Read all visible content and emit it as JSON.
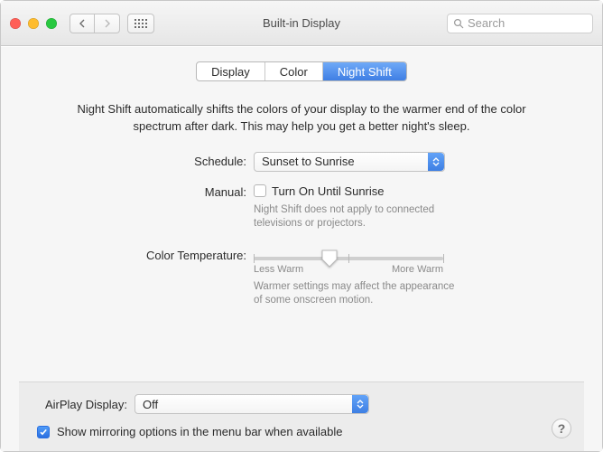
{
  "window": {
    "title": "Built-in Display"
  },
  "toolbar": {
    "search_placeholder": "Search"
  },
  "tabs": {
    "display": "Display",
    "color": "Color",
    "night_shift": "Night Shift",
    "active": "night_shift"
  },
  "intro": "Night Shift automatically shifts the colors of your display to the warmer end of the color spectrum after dark. This may help you get a better night's sleep.",
  "schedule": {
    "label": "Schedule:",
    "value": "Sunset to Sunrise"
  },
  "manual": {
    "label": "Manual:",
    "checkbox_label": "Turn On Until Sunrise",
    "checked": false,
    "note": "Night Shift does not apply to connected televisions or projectors."
  },
  "color_temp": {
    "label": "Color Temperature:",
    "min_label": "Less Warm",
    "max_label": "More Warm",
    "value_percent": 40,
    "note": "Warmer settings may affect the appearance of some onscreen motion."
  },
  "airplay": {
    "label": "AirPlay Display:",
    "value": "Off"
  },
  "mirroring": {
    "label": "Show mirroring options in the menu bar when available",
    "checked": true
  },
  "help_glyph": "?"
}
